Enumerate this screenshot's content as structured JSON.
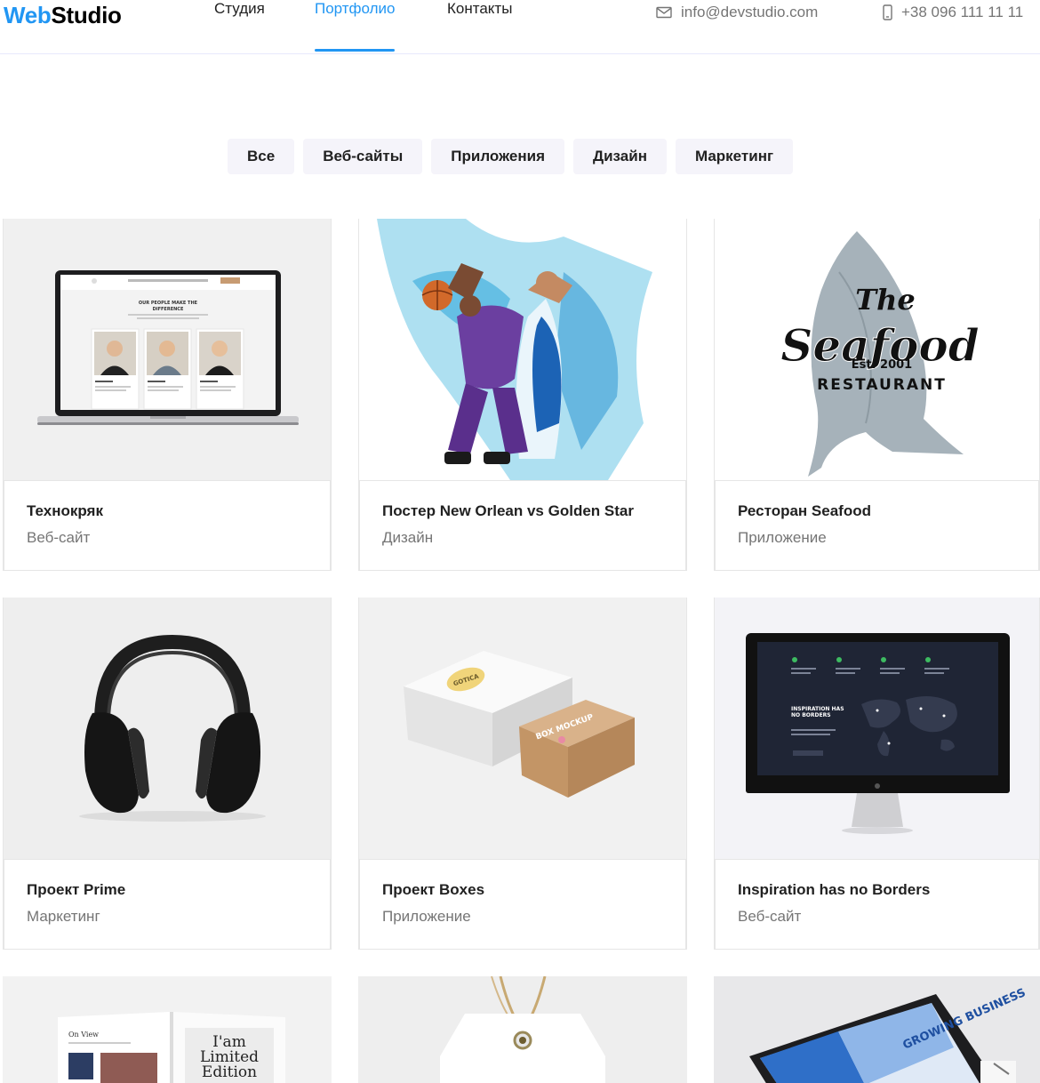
{
  "logo": {
    "part1": "Web",
    "part2": "Studio"
  },
  "nav": [
    {
      "label": "Студия",
      "active": false
    },
    {
      "label": "Портфолио",
      "active": true
    },
    {
      "label": "Контакты",
      "active": false
    }
  ],
  "contacts": {
    "email": "info@devstudio.com",
    "phone": "+38 096 111 11 11"
  },
  "filters": [
    "Все",
    "Веб-сайты",
    "Приложения",
    "Дизайн",
    "Маркетинг"
  ],
  "cards": [
    {
      "title": "Технокряк",
      "category": "Веб-сайт"
    },
    {
      "title": "Постер New Orlean vs Golden Star",
      "category": "Дизайн"
    },
    {
      "title": "Ресторан Seafood",
      "category": "Приложение"
    },
    {
      "title": "Проект Prime",
      "category": "Маркетинг"
    },
    {
      "title": "Проект Boxes",
      "category": "Приложение"
    },
    {
      "title": "Inspiration has no Borders",
      "category": "Веб-сайт"
    }
  ],
  "thumb_text": {
    "laptop_heading": "OUR PEOPLE MAKE THE DIFFERENCE",
    "seafood_the": "The",
    "seafood_name": "Seafood",
    "seafood_est": "Est. 2001",
    "seafood_restaurant": "RESTAURANT",
    "monitor_heading": "INSPIRATION HAS NO BORDERS",
    "box_lid": "BOX MOCKUP",
    "box_label": "GOTICA",
    "magazine_left": "On View",
    "magazine_right": "I'am Limited Edition",
    "growing": "GROWING BUSINESS"
  },
  "colors": {
    "accent": "#2196f3",
    "text": "#212121",
    "muted": "#757575",
    "filter_bg": "#f5f4fa"
  }
}
